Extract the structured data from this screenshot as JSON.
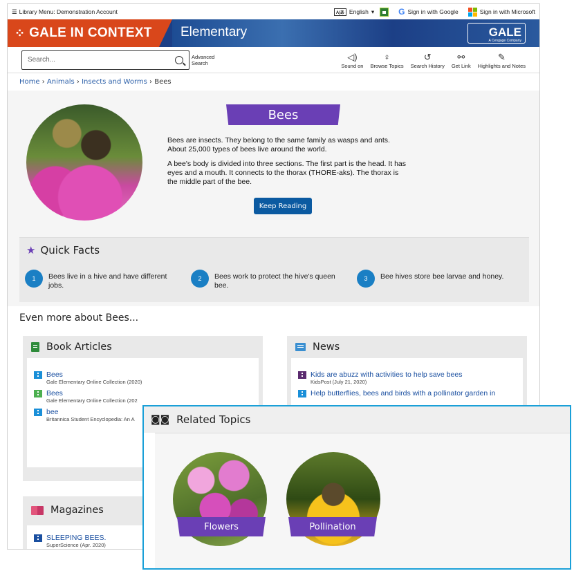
{
  "utility_bar": {
    "library_menu": "Library Menu: Demonstration Account",
    "language": "English",
    "google": "Sign in with Google",
    "microsoft": "Sign in with Microsoft"
  },
  "banner": {
    "brand": "GALE IN CONTEXT",
    "edition": "Elementary",
    "logo_main": "GALE",
    "logo_sub": "A Cengage Company"
  },
  "toolbar": {
    "search_placeholder": "Search...",
    "advanced_search_line1": "Advanced",
    "advanced_search_line2": "Search",
    "tools": [
      {
        "label": "Sound on",
        "icon": "speaker-icon"
      },
      {
        "label": "Browse Topics",
        "icon": "lightbulb-icon"
      },
      {
        "label": "Search History",
        "icon": "history-icon"
      },
      {
        "label": "Get Link",
        "icon": "link-icon"
      },
      {
        "label": "Highlights and Notes",
        "icon": "pencil-icon"
      }
    ]
  },
  "breadcrumb": {
    "items": [
      "Home",
      "Animals",
      "Insects and Worms"
    ],
    "current": "Bees"
  },
  "hero": {
    "title": "Bees",
    "paragraph1": "Bees are insects. They belong to the same family as wasps and ants. About 25,000 types of bees live around the world.",
    "paragraph2": "A bee's body is divided into three sections. The first part is the head. It has eyes and a mouth. It connects to the thorax (THORE-aks). The thorax is the middle part of the bee.",
    "button": "Keep Reading"
  },
  "quick_facts": {
    "title": "Quick Facts",
    "facts": [
      {
        "num": "1",
        "text": "Bees live in a hive and have different jobs."
      },
      {
        "num": "2",
        "text": "Bees work to protect the hive's queen bee."
      },
      {
        "num": "3",
        "text": "Bee hives store bee larvae and honey."
      }
    ]
  },
  "more_heading": "Even more about Bees...",
  "book_articles": {
    "title": "Book Articles",
    "items": [
      {
        "title": "Bees",
        "source": "Gale Elementary Online Collection (2020)",
        "color": "#1a8fd8"
      },
      {
        "title": "Bees",
        "source": "Gale Elementary Online Collection (202",
        "color": "#4caf50"
      },
      {
        "title": "bee",
        "source": "Britannica Student Encyclopedia: An A",
        "color": "#1a8fd8"
      }
    ]
  },
  "news": {
    "title": "News",
    "items": [
      {
        "title": "Kids are abuzz with activities to help save bees",
        "source": "KidsPost (July 21, 2020)",
        "color": "#5a2a6e"
      },
      {
        "title": "Help butterflies, bees and birds with a pollinator garden in",
        "source": "",
        "color": "#1a8fd8"
      }
    ]
  },
  "magazines": {
    "title": "Magazines",
    "items": [
      {
        "title": "SLEEPING BEES.",
        "source": "SuperScience (Apr. 2020)",
        "color": "#1a4fa0"
      }
    ]
  },
  "related_topics": {
    "title": "Related Topics",
    "topics": [
      "Flowers",
      "Pollination"
    ]
  },
  "colors": {
    "brand_orange": "#d9471b",
    "brand_blue": "#1c3f86",
    "accent_purple": "#6a3fb5",
    "button_blue": "#0b5aa1",
    "highlight_border": "#1aa0d8"
  }
}
